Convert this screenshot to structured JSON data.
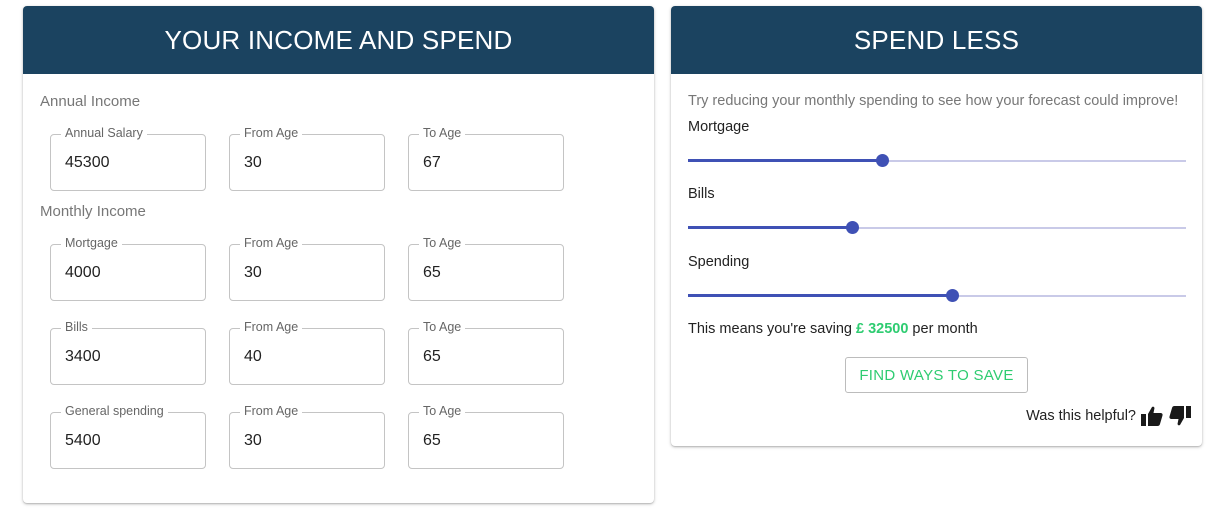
{
  "income": {
    "title": "YOUR INCOME AND SPEND",
    "annual_label": "Annual Income",
    "monthly_label": "Monthly Income",
    "rows": [
      {
        "name_label": "Annual Salary",
        "name_value": "45300",
        "from_label": "From Age",
        "from_value": "30",
        "to_label": "To Age",
        "to_value": "67"
      },
      {
        "name_label": "Mortgage",
        "name_value": "4000",
        "from_label": "From Age",
        "from_value": "30",
        "to_label": "To Age",
        "to_value": "65"
      },
      {
        "name_label": "Bills",
        "name_value": "3400",
        "from_label": "From Age",
        "from_value": "40",
        "to_label": "To Age",
        "to_value": "65"
      },
      {
        "name_label": "General spending",
        "name_value": "5400",
        "from_label": "From Age",
        "from_value": "30",
        "to_label": "To Age",
        "to_value": "65"
      }
    ]
  },
  "spend": {
    "title": "SPEND LESS",
    "intro": "Try reducing your monthly spending to see how your forecast could improve!",
    "sliders": [
      {
        "label": "Mortgage",
        "value_fraction": 0.39
      },
      {
        "label": "Bills",
        "value_fraction": 0.33
      },
      {
        "label": "Spending",
        "value_fraction": 0.53
      }
    ],
    "saving_prefix": "This means you're saving ",
    "saving_amount": "£ 32500",
    "saving_suffix": " per month",
    "save_button": "FIND WAYS TO SAVE",
    "helpful_text": "Was this helpful?"
  },
  "colors": {
    "header_bg": "#1b4360",
    "accent": "#3f51b5",
    "saving_green": "#2ecc71"
  },
  "icons": [
    "thumbs-up-icon",
    "thumbs-down-icon"
  ]
}
